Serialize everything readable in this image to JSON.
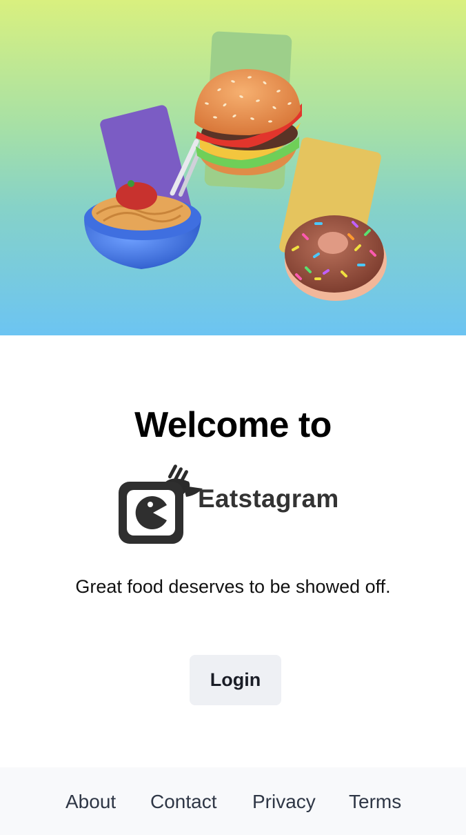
{
  "hero": {
    "illustrations": [
      "spaghetti-bowl-icon",
      "burger-icon",
      "donut-icon"
    ],
    "gradient_colors": [
      "#d9f07f",
      "#6cc4f2"
    ]
  },
  "main": {
    "welcome_heading": "Welcome to",
    "logo": {
      "icon": "camera-fork-logo-icon",
      "brand_text": "Eatstagram"
    },
    "tagline": "Great food deserves to be showed off.",
    "login_label": "Login"
  },
  "footer": {
    "links": [
      {
        "label": "About"
      },
      {
        "label": "Contact"
      },
      {
        "label": "Privacy"
      },
      {
        "label": "Terms"
      }
    ]
  },
  "colors": {
    "login_bg": "#eef0f4",
    "footer_bg": "#f8f9fb",
    "text_dark": "#1a1d26"
  }
}
